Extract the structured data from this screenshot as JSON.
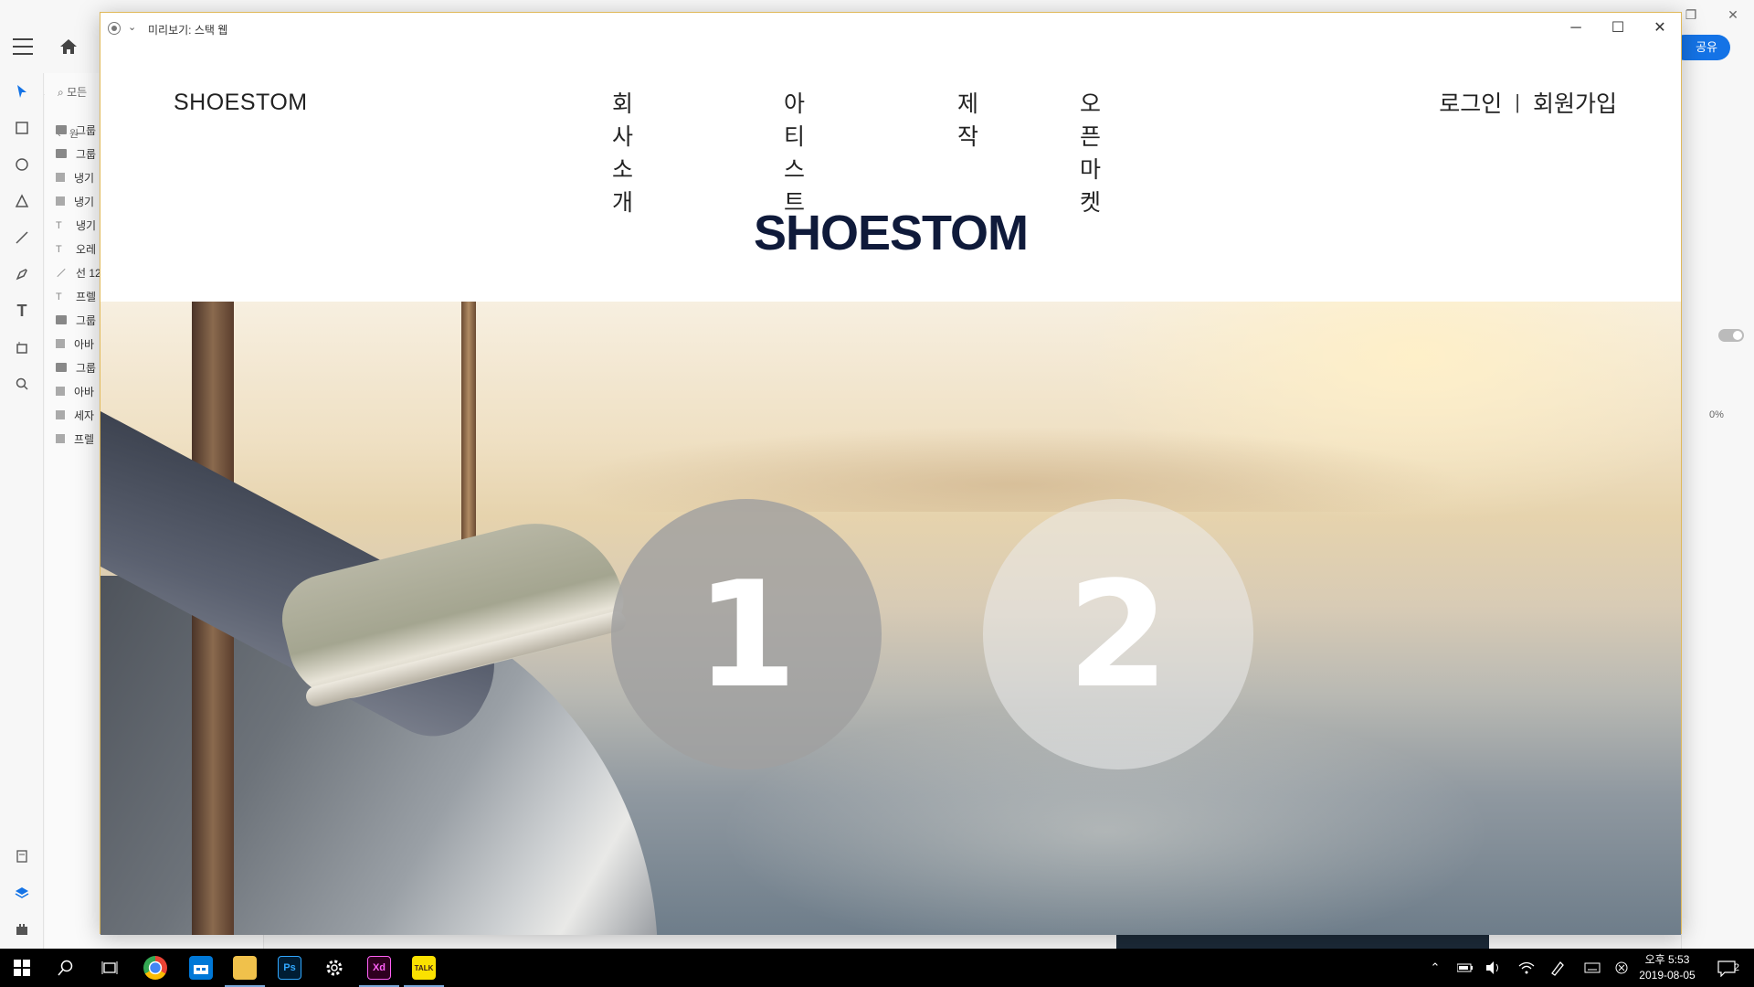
{
  "xd_app": {
    "share_label": "공유",
    "layers_search_label": "모든",
    "layers_back_label": "원",
    "layers": [
      {
        "icon": "folder-icon",
        "label": "그룹"
      },
      {
        "icon": "folder-icon",
        "label": "그룹"
      },
      {
        "icon": "rectangle-icon",
        "label": "냉기"
      },
      {
        "icon": "rectangle-icon",
        "label": "냉기"
      },
      {
        "icon": "text-icon",
        "label": "냉기"
      },
      {
        "icon": "text-icon",
        "label": "오레"
      },
      {
        "icon": "line-icon",
        "label": "선 12"
      },
      {
        "icon": "text-icon",
        "label": "프렐"
      },
      {
        "icon": "folder-icon",
        "label": "그룹"
      },
      {
        "icon": "rectangle-icon",
        "label": "아바"
      },
      {
        "icon": "folder-icon",
        "label": "그룹"
      },
      {
        "icon": "rectangle-icon",
        "label": "아바"
      },
      {
        "icon": "rectangle-icon",
        "label": "세자"
      },
      {
        "icon": "rectangle-icon",
        "label": "프렐"
      }
    ],
    "opacity_label": "0%"
  },
  "preview": {
    "title": "미리보기: 스택 웹",
    "controls": {
      "minimize": "─",
      "maximize": "☐",
      "close": "✕"
    }
  },
  "site": {
    "logo": "SHOESTOM",
    "nav": [
      "회사소개",
      "아티스트",
      "제작",
      "오픈마켓"
    ],
    "auth": {
      "login": "로그인",
      "separator": "|",
      "signup": "회원가입"
    },
    "brand": "SHOESTOM",
    "circles": [
      "1",
      "2"
    ]
  },
  "taskbar": {
    "apps": [
      {
        "name": "chrome",
        "label": ""
      },
      {
        "name": "store",
        "label": ""
      },
      {
        "name": "explorer",
        "label": ""
      },
      {
        "name": "photoshop",
        "label": "Ps"
      },
      {
        "name": "settings",
        "label": ""
      },
      {
        "name": "xd",
        "label": "Xd"
      },
      {
        "name": "kakaotalk",
        "label": "TALK"
      }
    ],
    "clock_time": "오후 5:53",
    "clock_date": "2019-08-05",
    "notification_count": "2"
  }
}
